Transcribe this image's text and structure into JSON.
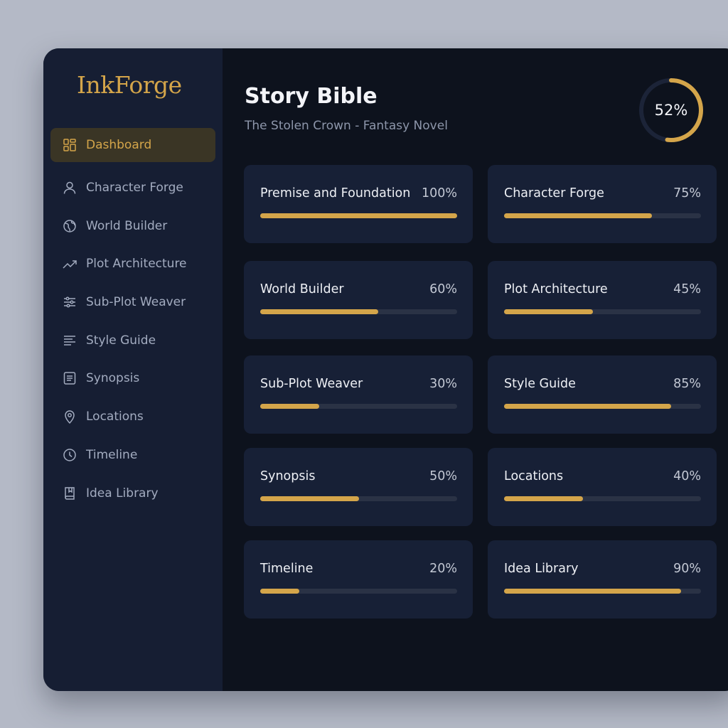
{
  "app": {
    "logo": "InkForge"
  },
  "sidebar": {
    "items": [
      {
        "label": "Dashboard",
        "icon": "dashboard-icon",
        "active": true
      },
      {
        "label": "Character Forge",
        "icon": "user-icon",
        "active": false
      },
      {
        "label": "World Builder",
        "icon": "globe-icon",
        "active": false
      },
      {
        "label": "Plot Architecture",
        "icon": "trend-up-icon",
        "active": false
      },
      {
        "label": "Sub-Plot Weaver",
        "icon": "sliders-icon",
        "active": false
      },
      {
        "label": "Style Guide",
        "icon": "text-lines-icon",
        "active": false
      },
      {
        "label": "Synopsis",
        "icon": "document-icon",
        "active": false
      },
      {
        "label": "Locations",
        "icon": "map-pin-icon",
        "active": false
      },
      {
        "label": "Timeline",
        "icon": "clock-icon",
        "active": false
      },
      {
        "label": "Idea Library",
        "icon": "book-icon",
        "active": false
      }
    ]
  },
  "header": {
    "title": "Story Bible",
    "subtitle": "The Stolen Crown - Fantasy Novel",
    "overall_progress_label": "52%",
    "overall_progress": 0.52
  },
  "cards": [
    {
      "name": "Premise and Foundation",
      "percent_label": "100%",
      "progress": 1.0
    },
    {
      "name": "Character Forge",
      "percent_label": "75%",
      "progress": 0.75
    },
    {
      "name": "World Builder",
      "percent_label": "60%",
      "progress": 0.6
    },
    {
      "name": "Plot Architecture",
      "percent_label": "45%",
      "progress": 0.45
    },
    {
      "name": "Sub-Plot Weaver",
      "percent_label": "30%",
      "progress": 0.3
    },
    {
      "name": "Style Guide",
      "percent_label": "85%",
      "progress": 0.85
    },
    {
      "name": "Synopsis",
      "percent_label": "50%",
      "progress": 0.5
    },
    {
      "name": "Locations",
      "percent_label": "40%",
      "progress": 0.4
    },
    {
      "name": "Timeline",
      "percent_label": "20%",
      "progress": 0.2
    },
    {
      "name": "Idea Library",
      "percent_label": "90%",
      "progress": 0.9
    }
  ],
  "colors": {
    "accent": "#d4a54a",
    "sidebar_bg": "#161e33",
    "main_bg": "#0d121d",
    "card_bg": "#172036",
    "track": "#2a3245"
  }
}
